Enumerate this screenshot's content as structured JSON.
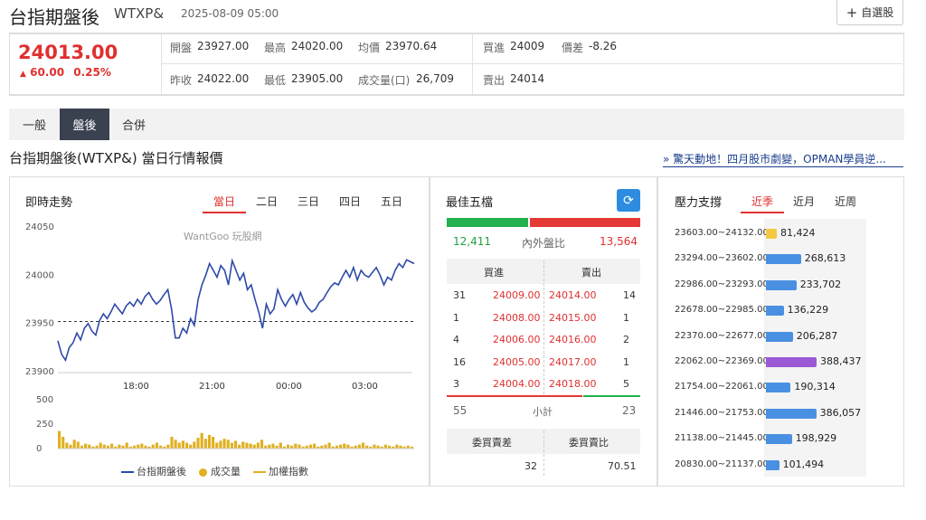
{
  "header": {
    "title": "台指期盤後",
    "code": "WTXP&",
    "datetime": "2025-08-09 05:00",
    "add_label": "自選股"
  },
  "quote": {
    "price": "24013.00",
    "change": "60.00",
    "change_pct": "0.25%",
    "open_label": "開盤",
    "open": "23927.00",
    "high_label": "最高",
    "high": "24020.00",
    "avg_label": "均價",
    "avg": "23970.64",
    "bid_label": "買進",
    "bid": "24009",
    "diff_label": "價差",
    "diff": "-8.26",
    "prev_label": "昨收",
    "prev": "24022.00",
    "low_label": "最低",
    "low": "23905.00",
    "vol_label": "成交量(口)",
    "vol": "26,709",
    "ask_label": "賣出",
    "ask": "24014"
  },
  "tabs": [
    "一般",
    "盤後",
    "合併"
  ],
  "subtitle": "台指期盤後(WTXP&) 當日行情報價",
  "news_link": "» 驚天動地！四月股市劇變，OPMAN學員逆...",
  "realtime": {
    "title": "即時走勢",
    "tabs": [
      "當日",
      "二日",
      "三日",
      "四日",
      "五日"
    ],
    "watermark": "WantGoo 玩股網",
    "legend": [
      "台指期盤後",
      "成交量",
      "加權指數"
    ]
  },
  "orderbook": {
    "title": "最佳五檔",
    "inner": "12,411",
    "outer": "13,564",
    "ratio_label": "內外盤比",
    "bid_header": "買進",
    "ask_header": "賣出",
    "rows": [
      {
        "bq": "31",
        "bp": "24009.00",
        "ap": "24014.00",
        "aq": "14"
      },
      {
        "bq": "1",
        "bp": "24008.00",
        "ap": "24015.00",
        "aq": "1"
      },
      {
        "bq": "4",
        "bp": "24006.00",
        "ap": "24016.00",
        "aq": "2"
      },
      {
        "bq": "16",
        "bp": "24005.00",
        "ap": "24017.00",
        "aq": "1"
      },
      {
        "bq": "3",
        "bp": "24004.00",
        "ap": "24018.00",
        "aq": "5"
      }
    ],
    "sub_bid": "55",
    "sub_label": "小計",
    "sub_ask": "23",
    "diff_label": "委買賣差",
    "ratio2_label": "委買賣比",
    "diff_val": "32",
    "ratio2_val": "70.51",
    "bar_ratio": 0.42
  },
  "pressure": {
    "title": "壓力支撐",
    "tabs": [
      "近季",
      "近月",
      "近周"
    ],
    "rows": [
      {
        "range": "23603.00~24132.00",
        "value": "81,424",
        "v": 81424,
        "color": "#f5c842"
      },
      {
        "range": "23294.00~23602.00",
        "value": "268,613",
        "v": 268613,
        "color": "#4a90e2"
      },
      {
        "range": "22986.00~23293.00",
        "value": "233,702",
        "v": 233702,
        "color": "#4a90e2"
      },
      {
        "range": "22678.00~22985.00",
        "value": "136,229",
        "v": 136229,
        "color": "#4a90e2"
      },
      {
        "range": "22370.00~22677.00",
        "value": "206,287",
        "v": 206287,
        "color": "#4a90e2"
      },
      {
        "range": "22062.00~22369.00",
        "value": "388,437",
        "v": 388437,
        "color": "#9b59d6"
      },
      {
        "range": "21754.00~22061.00",
        "value": "190,314",
        "v": 190314,
        "color": "#4a90e2"
      },
      {
        "range": "21446.00~21753.00",
        "value": "386,057",
        "v": 386057,
        "color": "#4a90e2"
      },
      {
        "range": "21138.00~21445.00",
        "value": "198,929",
        "v": 198929,
        "color": "#4a90e2"
      },
      {
        "range": "20830.00~21137.00",
        "value": "101,494",
        "v": 101494,
        "color": "#4a90e2"
      }
    ]
  },
  "chart_data": {
    "type": "line",
    "xlabels": [
      "18:00",
      "21:00",
      "00:00",
      "03:00"
    ],
    "ylabels": [
      "24050",
      "24000",
      "23950",
      "23900"
    ],
    "ylim": [
      23900,
      24050
    ],
    "ref_price": 23952,
    "ref_line": "dashed",
    "vol_ylabels": [
      "500",
      "250",
      "0"
    ],
    "vol_ylim": [
      0,
      500
    ],
    "series": [
      {
        "name": "台指期盤後",
        "color": "#2e4aa8",
        "values": [
          23932,
          23918,
          23912,
          23925,
          23930,
          23940,
          23933,
          23945,
          23950,
          23942,
          23938,
          23953,
          23960,
          23955,
          23962,
          23970,
          23965,
          23960,
          23968,
          23972,
          23968,
          23975,
          23970,
          23978,
          23982,
          23975,
          23970,
          23974,
          23980,
          23985,
          23965,
          23935,
          23935,
          23945,
          23940,
          23955,
          23948,
          23975,
          23990,
          24000,
          24012,
          24005,
          23998,
          24010,
          24005,
          23990,
          24015,
          24005,
          23995,
          24002,
          23985,
          23990,
          23975,
          23962,
          23945,
          23970,
          23960,
          23965,
          23985,
          23975,
          23968,
          23975,
          23980,
          23970,
          23982,
          23972,
          23966,
          23962,
          23965,
          23972,
          23975,
          23982,
          23988,
          23992,
          23990,
          23998,
          24005,
          23998,
          24008,
          23995,
          24005,
          24000,
          23998,
          24003,
          24008,
          24000,
          23990,
          23998,
          23995,
          24005,
          24012,
          24008,
          24016,
          24014,
          24012
        ]
      },
      {
        "name": "成交量",
        "color": "#e0b020",
        "values": [
          180,
          120,
          60,
          40,
          90,
          70,
          30,
          50,
          40,
          20,
          30,
          60,
          40,
          30,
          50,
          20,
          40,
          30,
          60,
          20,
          30,
          40,
          50,
          30,
          20,
          40,
          60,
          30,
          20,
          40,
          120,
          90,
          60,
          80,
          60,
          40,
          70,
          110,
          160,
          100,
          140,
          120,
          60,
          80,
          100,
          90,
          60,
          80,
          40,
          70,
          60,
          50,
          40,
          60,
          90,
          30,
          40,
          50,
          30,
          60,
          20,
          40,
          30,
          50,
          40,
          20,
          30,
          40,
          50,
          20,
          30,
          40,
          60,
          20,
          30,
          40,
          50,
          40,
          20,
          30,
          40,
          60,
          30,
          20,
          40,
          30,
          20,
          40,
          30,
          20,
          40,
          30,
          20,
          30,
          20
        ]
      }
    ]
  }
}
